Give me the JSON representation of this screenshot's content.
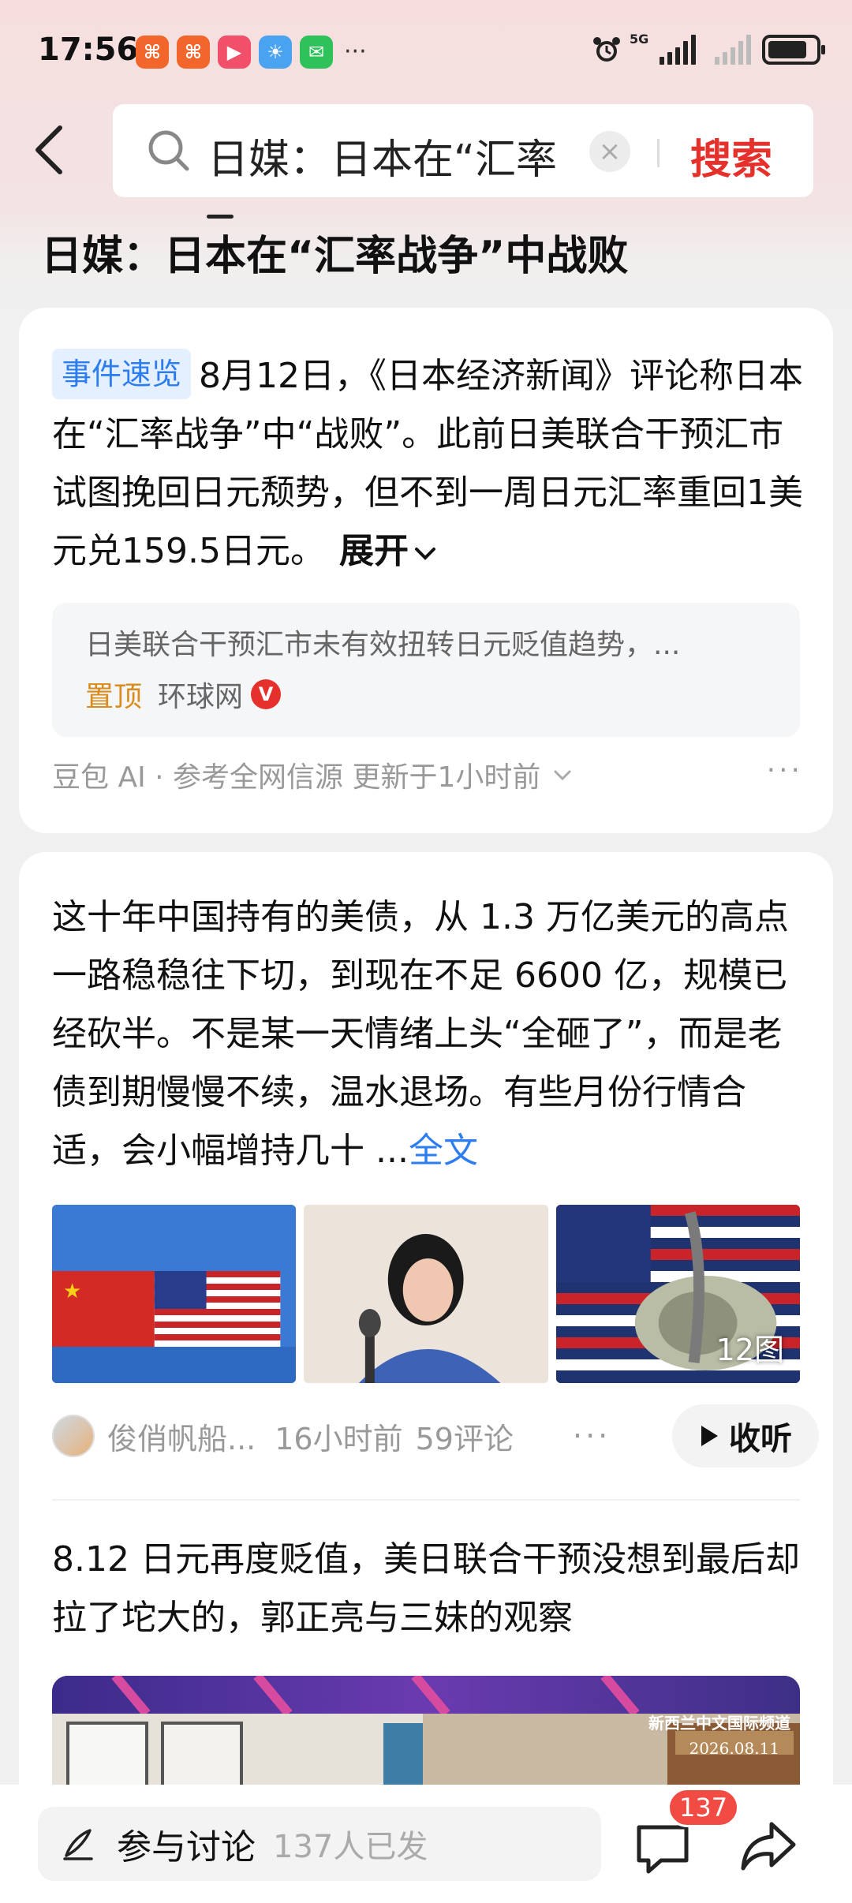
{
  "status_bar": {
    "time": "17:56",
    "more": "···",
    "network": "5G"
  },
  "search": {
    "query": "日媒：日本在“汇率",
    "clear": "×",
    "button_label": "搜索"
  },
  "page_title": "日媒：日本在“汇率战争”中战败",
  "event_card": {
    "tag": "事件速览",
    "summary": "8月12日，《日本经济新闻》评论称日本在“汇率战争”中“战败”。此前日美联合干预汇市试图挽回日元颓势，但不到一周日元汇率重回1美元兑159.5日元。",
    "expand_label": "展开",
    "quote": "日美联合干预汇市未有效扭转日元贬值趋势，...",
    "quote_pin": "置顶",
    "quote_source": "环球网",
    "verified": "V",
    "footer": "豆包 AI · 参考全网信源 更新于1小时前",
    "footer_more": "···"
  },
  "article1": {
    "text": "这十年中国持有的美债，从 1.3 万亿美元的高点一路稳稳往下切，到现在不足 6600 亿，规模已经砍半。不是某一天情绪上头“全砸了”，而是老债到期慢慢不续，温水退场。有些月份行情合适，会小幅增持几十 ...",
    "fulltext_label": "全文",
    "image_count": "12图",
    "author": "俊俏帆船...",
    "time": "16小时前",
    "comments": "59评论",
    "more": "···",
    "listen_label": "收听"
  },
  "article2": {
    "title": "8.12 日元再度贬值，美日联合干预没想到最后却拉了坨大的，郭正亮与三妹的观察",
    "video_caption": "新西兰中文国际频道",
    "video_date": "2026.08.11"
  },
  "bottom_bar": {
    "discuss_label": "参与讨论",
    "discuss_count": "137人已发",
    "comment_badge": "137"
  },
  "colors": {
    "accent_red": "#e5302b",
    "link_blue": "#2d7df2",
    "pin_orange": "#d98b1b"
  }
}
